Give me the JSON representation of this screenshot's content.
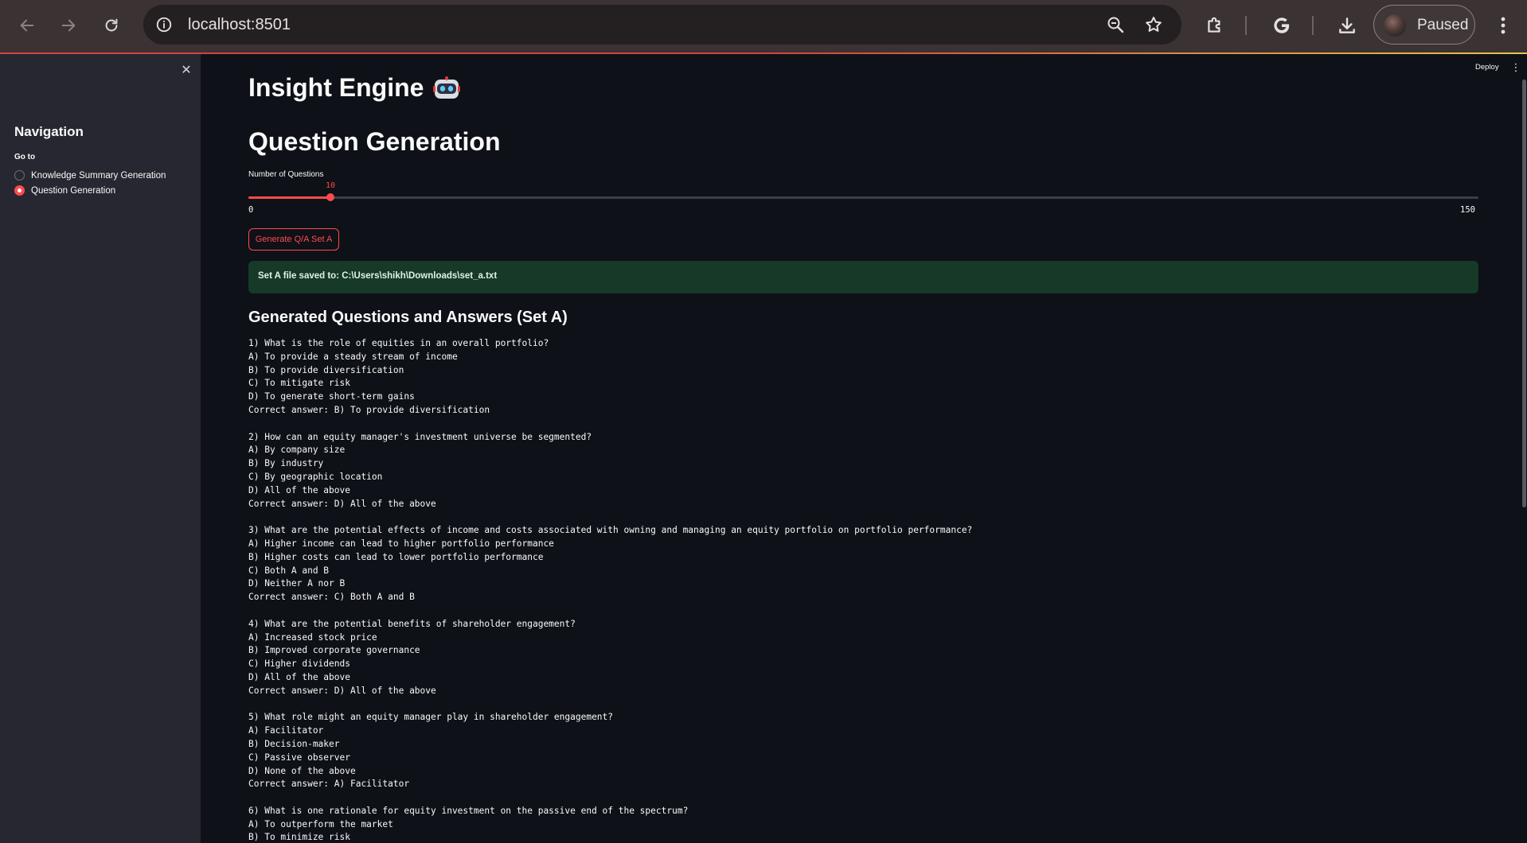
{
  "browser": {
    "url": "localhost:8501",
    "profile_label": "Paused",
    "icons": [
      "back-arrow-icon",
      "forward-arrow-icon",
      "reload-icon",
      "site-info-icon",
      "zoom-icon",
      "bookmark-star-icon",
      "extensions-icon",
      "google-icon",
      "download-icon",
      "menu-kebab-icon"
    ]
  },
  "sidebar": {
    "title": "Navigation",
    "goto_label": "Go to",
    "options": [
      {
        "label": "Knowledge Summary Generation",
        "selected": false
      },
      {
        "label": "Question Generation",
        "selected": true
      }
    ]
  },
  "header": {
    "deploy_label": "Deploy"
  },
  "main": {
    "app_title": "Insight Engine",
    "page_title": "Question Generation",
    "slider": {
      "label": "Number of Questions",
      "value": "10",
      "min": "0",
      "max": "150",
      "fraction": 0.0667
    },
    "generate_button": "Generate Q/A Set A",
    "success_message": "Set A file saved to: C:\\Users\\shikh\\Downloads\\set_a.txt",
    "results_heading": "Generated Questions and Answers (Set A)",
    "qa": [
      {
        "question": "1) What is the role of equities in an overall portfolio?",
        "options": [
          "A) To provide a steady stream of income",
          "B) To provide diversification",
          "C) To mitigate risk",
          "D) To generate short-term gains"
        ],
        "answer": "Correct answer: B) To provide diversification"
      },
      {
        "question": "2) How can an equity manager's investment universe be segmented?",
        "options": [
          "A) By company size",
          "B) By industry",
          "C) By geographic location",
          "D) All of the above"
        ],
        "answer": "Correct answer: D) All of the above"
      },
      {
        "question": "3) What are the potential effects of income and costs associated with owning and managing an equity portfolio on portfolio performance?",
        "options": [
          "A) Higher income can lead to higher portfolio performance",
          "B) Higher costs can lead to lower portfolio performance",
          "C) Both A and B",
          "D) Neither A nor B"
        ],
        "answer": "Correct answer: C) Both A and B"
      },
      {
        "question": "4) What are the potential benefits of shareholder engagement?",
        "options": [
          "A) Increased stock price",
          "B) Improved corporate governance",
          "C) Higher dividends",
          "D) All of the above"
        ],
        "answer": "Correct answer: D) All of the above"
      },
      {
        "question": "5) What role might an equity manager play in shareholder engagement?",
        "options": [
          "A) Facilitator",
          "B) Decision-maker",
          "C) Passive observer",
          "D) None of the above"
        ],
        "answer": "Correct answer: A) Facilitator"
      },
      {
        "question": "6) What is one rationale for equity investment on the passive end of the spectrum?",
        "options": [
          "A) To outperform the market",
          "B) To minimize risk"
        ],
        "answer": ""
      }
    ]
  },
  "colors": {
    "accent": "#ff4b4b",
    "app_bg": "#0e1117",
    "sidebar_bg": "#262730",
    "success_bg": "#173928",
    "chrome_bg": "#3a3233"
  }
}
